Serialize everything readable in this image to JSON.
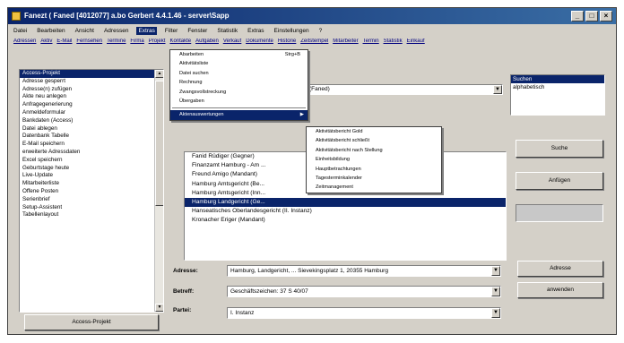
{
  "window": {
    "title": "Fanezt ( Faned [4012077] a.bo Gerbert 4.4.1.46 - server\\Sapp",
    "min_glyph": "_",
    "max_glyph": "□",
    "close_glyph": "×"
  },
  "menubar": [
    "Datei",
    "Bearbeiten",
    "Ansicht",
    "Adressen",
    "Extras",
    "Filter",
    "Fenster",
    "Statistik",
    "Extras",
    "Einstellungen",
    "?"
  ],
  "menubar_active_index": 4,
  "linkbar": [
    "Adressen",
    "Aktiv",
    "E-Mail",
    "Fernsehen",
    "Termine",
    "Firma",
    "Projekt",
    "Kontakte",
    "Aufgaben",
    "Verkauf",
    "Dokumente",
    "Historie",
    "Zeitstempel",
    "Mitarbeiter",
    "Termin",
    "Statistik",
    "Einkauf"
  ],
  "left_list": {
    "items": [
      "Access-Projekt",
      "Adresse gesperrt",
      "Adresse(n) zufügen",
      "Akte neu anlegen",
      "Anfragegenerierung",
      "Anmeldeformular",
      "Bankdaten (Access)",
      "Datei ablegen",
      "Datenbank Tabelle",
      "E-Mail speichern",
      "erweiterte Adressdaten",
      "Excel speichern",
      "Geburtstage heute",
      "Live-Update",
      "Mitarbeiterliste",
      "Offene Posten",
      "Serienbrief",
      "Setup-Assistent",
      "Tabellenlayout"
    ],
    "selected_index": 0
  },
  "access_button": "Access-Projekt",
  "top_combo": {
    "value": "(Faned)"
  },
  "right_list": {
    "items": [
      "Suchen",
      "alphabetisch"
    ],
    "selected_index": 0
  },
  "right_buttons": {
    "b1": "Suche",
    "b2": "Anfügen",
    "b3": "Adresse",
    "b4": "anwenden"
  },
  "mid_list": {
    "items": [
      "Fanid Rüdiger (Gegner)",
      "Finanzamt Hamburg - Am ...",
      "Freund Amigo (Mandant)",
      "Hamburg Amtsgericht (Be...",
      "Hamburg Amtsgericht (Inn...",
      "Hamburg Landgericht (Ge...",
      "Hanseatisches Oberlandesgericht (II. Instanz)",
      "Kronacher Eriger (Mandant)"
    ],
    "selected_index": 5
  },
  "fields": {
    "adresse_label": "Adresse:",
    "adresse_value": "Hamburg, Landgericht, ... Sievekingsplatz 1, 20355 Hamburg",
    "betreff_label": "Betreff:",
    "betreff_value": "Geschäftszeichen: 37 S 40/07",
    "partei_label": "Partei:",
    "partei_value": "I. Instanz"
  },
  "menu1": {
    "items": [
      {
        "label": "Abarbeiten",
        "shortcut": "Strg+B"
      },
      {
        "label": "Aktivitätsliste"
      },
      {
        "label": "Datei suchen"
      },
      {
        "label": "Rechnung"
      },
      {
        "label": "Zwangsvollstreckung"
      },
      {
        "label": "Übergaben"
      },
      {
        "label": "Aktenauswertungen",
        "submenu": "▶"
      }
    ],
    "selected_index": 6
  },
  "menu2": {
    "items": [
      "Aktivitätsbericht Gold",
      "Aktivitätsbericht schließt",
      "Aktivitätsbericht nach Stellung",
      "Einheitsbildung",
      "Hauptbetrachtungen",
      "Tagesterminkalender",
      "Zeitmanagement"
    ]
  }
}
